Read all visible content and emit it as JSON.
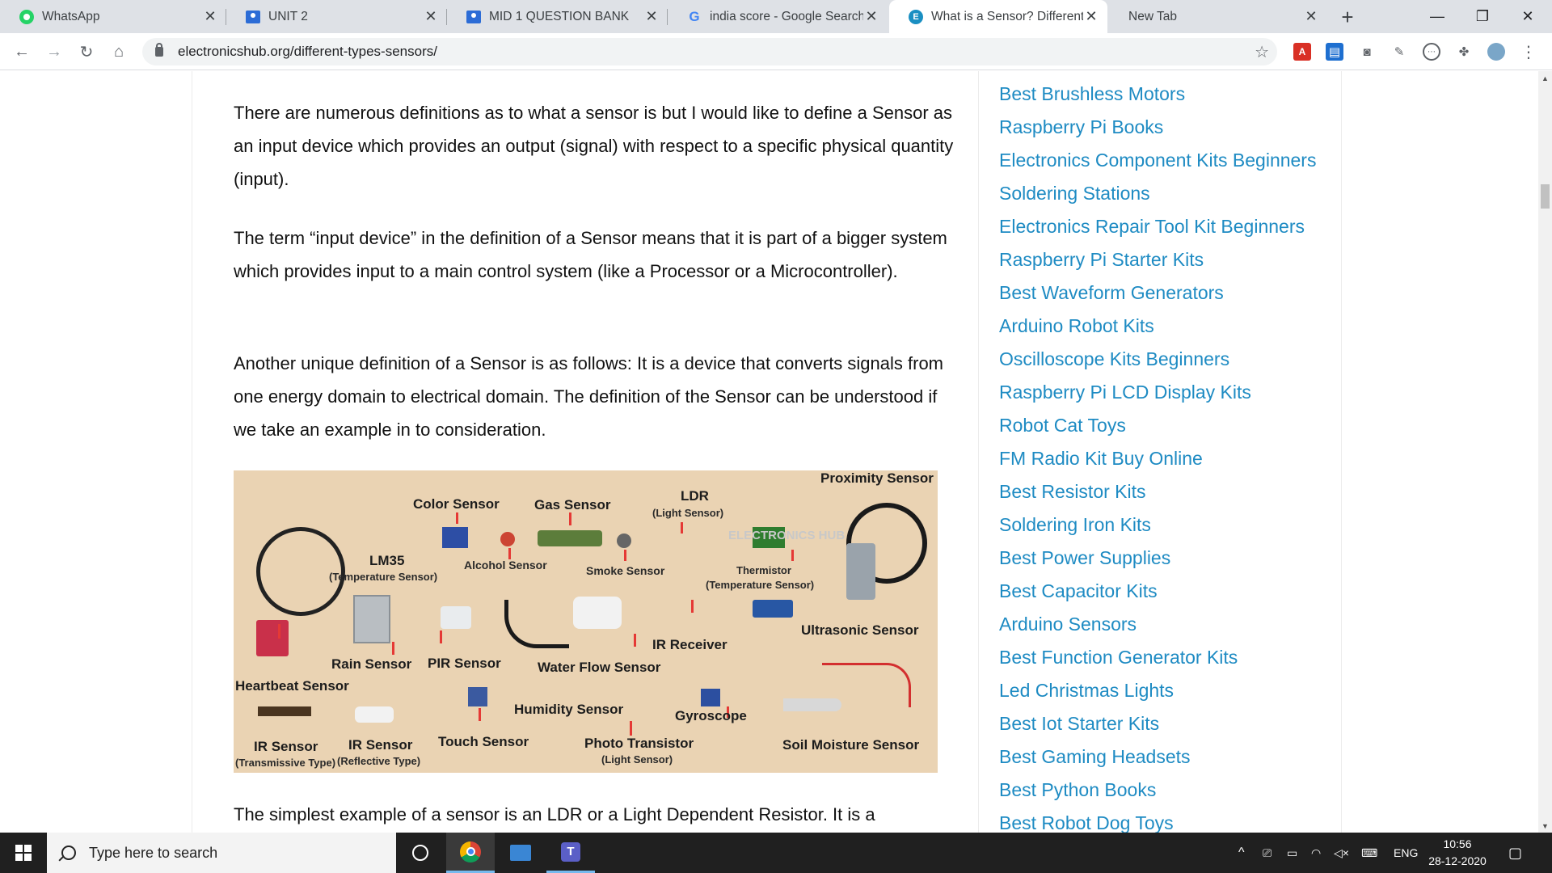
{
  "tabs": [
    {
      "title": "WhatsApp",
      "icon": "whatsapp-icon"
    },
    {
      "title": "UNIT 2",
      "icon": "classroom-icon"
    },
    {
      "title": "MID 1 QUESTION BANK",
      "icon": "classroom-icon"
    },
    {
      "title": "india score - Google Search",
      "icon": "google-icon"
    },
    {
      "title": "What is a Sensor? Different T",
      "icon": "electronicshub-icon",
      "active": true
    },
    {
      "title": "New Tab",
      "icon": ""
    }
  ],
  "address": {
    "url": "electronicshub.org/different-types-sensors/"
  },
  "article": {
    "paragraphs": [
      "There are numerous definitions as to what a sensor is but I would like to define a Sensor as an input device which provides an output (signal) with respect to a specific physical quantity (input).",
      "The term “input device” in the definition of a Sensor means that it is part of a bigger system which provides input to a main control system (like a Processor or a Microcontroller).",
      "Another unique definition of a Sensor is as follows: It is a device that converts signals from one energy domain to electrical domain. The definition of the Sensor can be understood if we take an example in to consideration.",
      "The simplest example of a sensor is an LDR or a Light Dependent Resistor. It is a"
    ],
    "figure": {
      "labels": {
        "proximity": "Proximity Sensor",
        "color": "Color Sensor",
        "gas": "Gas Sensor",
        "ldr": "LDR",
        "ldr_sub": "(Light Sensor)",
        "lm35": "LM35",
        "lm35_sub": "(Temperature Sensor)",
        "alcohol": "Alcohol Sensor",
        "smoke": "Smoke Sensor",
        "thermistor": "Thermistor",
        "thermistor_sub": "(Temperature Sensor)",
        "ultrasonic": "Ultrasonic Sensor",
        "ir_receiver": "IR Receiver",
        "rain": "Rain Sensor",
        "pir": "PIR Sensor",
        "water_flow": "Water Flow Sensor",
        "heartbeat": "Heartbeat Sensor",
        "humidity": "Humidity Sensor",
        "gyroscope": "Gyroscope",
        "ir_trans": "IR Sensor",
        "ir_trans_sub": "(Transmissive Type)",
        "ir_refl": "IR Sensor",
        "ir_refl_sub": "(Reflective Type)",
        "touch": "Touch Sensor",
        "photo": "Photo Transistor",
        "photo_sub": "(Light Sensor)",
        "soil": "Soil Moisture Sensor",
        "watermark": "ELECTRONICS HUB"
      }
    }
  },
  "sidebar": {
    "links": [
      "Best Brushless Motors",
      "Raspberry Pi Books",
      "Electronics Component Kits Beginners",
      "Soldering Stations",
      "Electronics Repair Tool Kit Beginners",
      "Raspberry Pi Starter Kits",
      "Best Waveform Generators",
      "Arduino Robot Kits",
      "Oscilloscope Kits Beginners",
      "Raspberry Pi LCD Display Kits",
      "Robot Cat Toys",
      "FM Radio Kit Buy Online",
      "Best Resistor Kits",
      "Soldering Iron Kits",
      "Best Power Supplies",
      "Best Capacitor Kits",
      "Arduino Sensors",
      "Best Function Generator Kits",
      "Led Christmas Lights",
      "Best Iot Starter Kits",
      "Best Gaming Headsets",
      "Best Python Books",
      "Best Robot Dog Toys"
    ]
  },
  "taskbar": {
    "search_placeholder": "Type here to search",
    "language": "ENG",
    "time": "10:56",
    "date": "28-12-2020"
  },
  "colors": {
    "link": "#1e8bc3",
    "figure_bg": "#ead3b3",
    "arrow": "#e53935"
  }
}
